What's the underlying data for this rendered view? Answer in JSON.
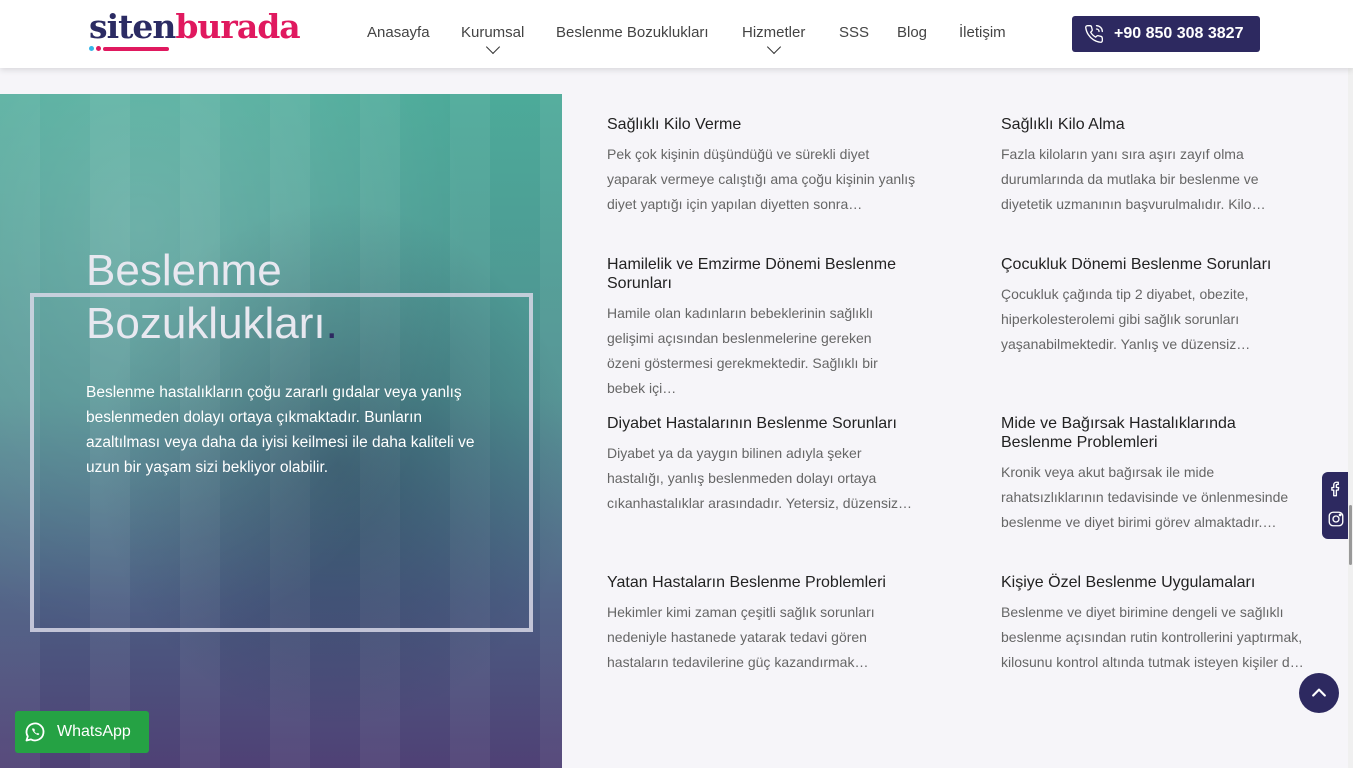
{
  "header": {
    "logo_part1": "siten",
    "logo_part2": "burada",
    "nav": [
      {
        "label": "Anasayfa"
      },
      {
        "label": "Kurumsal"
      },
      {
        "label": "Beslenme Bozuklukları"
      },
      {
        "label": "Hizmetler"
      },
      {
        "label": "SSS"
      },
      {
        "label": "Blog"
      },
      {
        "label": "İletişim"
      }
    ],
    "phone": "+90 850 308 3827"
  },
  "hero": {
    "title_line1": "Beslenme",
    "title_line2": "Bozuklukları",
    "title_dot": ".",
    "description": "Beslenme hastalıkların çoğu zararlı gıdalar veya yanlış beslenmeden dolayı ortaya çıkmaktadır. Bunların azaltılması veya daha da iyisi keilmesi ile daha kaliteli ve uzun bir yaşam sizi bekliyor olabilir."
  },
  "services": [
    {
      "title": "Sağlıklı Kilo Verme",
      "desc": "Pek çok kişinin düşündüğü ve sürekli diyet yaparak vermeye calıştığı ama çoğu kişinin yanlış diyet yaptığı için yapılan diyetten sonra…"
    },
    {
      "title": "Sağlıklı Kilo Alma",
      "desc": "Fazla kiloların yanı sıra aşırı zayıf olma durumlarında da mutlaka bir beslenme ve diyetetik uzmanının başvurulmalıdır. Kilo…"
    },
    {
      "title": "Hamilelik ve Emzirme Dönemi Beslenme Sorunları",
      "desc": "Hamile olan kadınların bebeklerinin sağlıklı gelişimi açısından beslenmelerine gereken özeni göstermesi gerekmektedir. Sağlıklı bir bebek içi…"
    },
    {
      "title": "Çocukluk Dönemi Beslenme Sorunları",
      "desc": "Çocukluk çağında tip 2 diyabet, obezite, hiperkolesterolemi gibi sağlık sorunları yaşanabilmektedir. Yanlış ve düzensiz…"
    },
    {
      "title": "Diyabet Hastalarının Beslenme Sorunları",
      "desc": "Diyabet ya da yaygın bilinen adıyla şeker hastalığı, yanlış beslenmeden dolayı ortaya cıkanhastalıklar arasındadır. Yetersiz, düzensiz…"
    },
    {
      "title": "Mide ve Bağırsak Hastalıklarında Beslenme Problemleri",
      "desc": "Kronik veya akut bağırsak ile mide rahatsızlıklarının tedavisinde ve önlenmesinde beslenme ve diyet birimi görev almaktadır.…"
    },
    {
      "title": "Yatan Hastaların Beslenme Problemleri",
      "desc": "Hekimler kimi zaman çeşitli sağlık sorunları nedeniyle hastanede yatarak tedavi gören hastaların tedavilerine güç kazandırmak…"
    },
    {
      "title": "Kişiye Özel Beslenme Uygulamaları",
      "desc": "Beslenme ve diyet birimine dengeli ve sağlıklı beslenme açısından rutin kontrollerini yaptırmak, kilosunu kontrol altında tutmak isteyen kişiler d…"
    }
  ],
  "whatsapp": {
    "label": "WhatsApp"
  },
  "icons": {
    "phone": "phone-icon",
    "facebook": "facebook-icon",
    "instagram": "instagram-icon",
    "scroll_top": "chevron-up-icon",
    "whatsapp": "whatsapp-icon"
  },
  "colors": {
    "brand_dark": "#2d2960",
    "brand_pink": "#e0195f",
    "whatsapp_green": "#25a244"
  }
}
